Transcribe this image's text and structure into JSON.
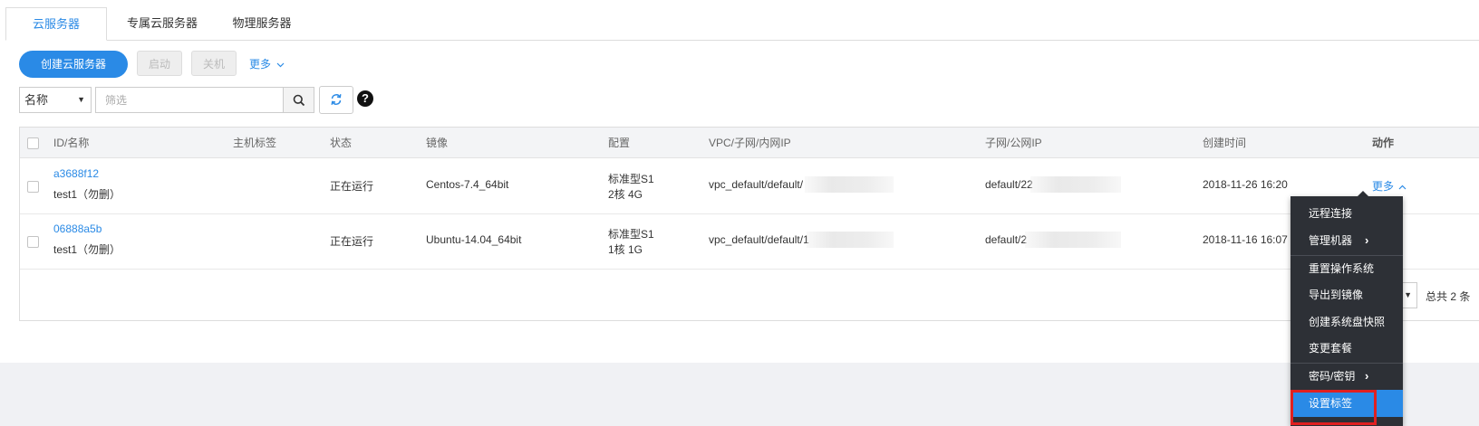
{
  "tabs": [
    {
      "label": "云服务器",
      "active": true
    },
    {
      "label": "专属云服务器",
      "active": false
    },
    {
      "label": "物理服务器",
      "active": false
    }
  ],
  "toolbar": {
    "create_label": "创建云服务器",
    "start_label": "启动",
    "shutdown_label": "关机",
    "more_label": "更多"
  },
  "filter": {
    "select_value": "名称",
    "placeholder": "筛选"
  },
  "table": {
    "headers": [
      "ID/名称",
      "主机标签",
      "状态",
      "镜像",
      "配置",
      "VPC/子网/内网IP",
      "子网/公网IP",
      "创建时间",
      "动作"
    ],
    "rows": [
      {
        "id": "a3688f12",
        "name": "test1（勿删）",
        "status": "正在运行",
        "image": "Centos-7.4_64bit",
        "config_line1": "标准型S1",
        "config_line2": "2核 4G",
        "vpc": "vpc_default/default/",
        "subnet": "default/22",
        "created": "2018-11-26 16:20",
        "action": "更多"
      },
      {
        "id": "06888a5b",
        "name": "test1（勿删）",
        "status": "正在运行",
        "image": "Ubuntu-14.04_64bit",
        "config_line1": "标准型S1",
        "config_line2": "1核 1G",
        "vpc": "vpc_default/default/1",
        "subnet": "default/2",
        "created": "2018-11-16 16:07",
        "action": "更多"
      }
    ]
  },
  "pager": {
    "page_size": "10",
    "total": "总共 2 条"
  },
  "menu": {
    "items": [
      {
        "label": "远程连接",
        "submenu": false
      },
      {
        "label": "管理机器",
        "submenu": true
      },
      {
        "label": "重置操作系统",
        "submenu": false
      },
      {
        "label": "导出到镜像",
        "submenu": false
      },
      {
        "label": "创建系统盘快照",
        "submenu": false
      },
      {
        "label": "变更套餐",
        "submenu": false
      },
      {
        "label": "密码/密钥",
        "submenu": true
      },
      {
        "label": "设置标签",
        "submenu": false
      }
    ]
  },
  "colors": {
    "accent": "#2a8ae6",
    "menu_bg": "#2d3036",
    "highlight_border": "#e02020"
  }
}
